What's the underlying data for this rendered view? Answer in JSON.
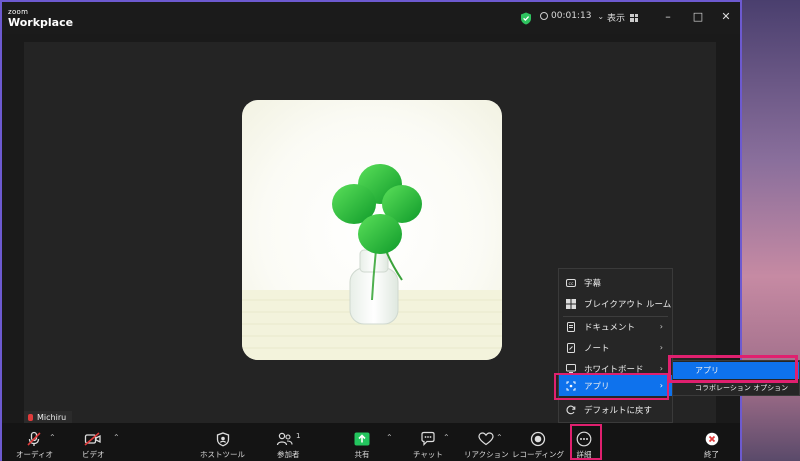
{
  "app": {
    "logo_top": "zoom",
    "logo_main": "Workplace"
  },
  "titlebar": {
    "timer": "00:01:13",
    "view_label": "表示"
  },
  "participant": {
    "name": "Michiru"
  },
  "toolbar": {
    "audio": "オーディオ",
    "video": "ビデオ",
    "host_tools": "ホストツール",
    "participants": "参加者",
    "participants_count": "1",
    "share": "共有",
    "chat": "チャット",
    "reactions": "リアクション",
    "recording": "レコーディング",
    "more": "詳細",
    "end": "終了"
  },
  "more_menu": {
    "items": [
      {
        "label": "字幕",
        "icon": "cc-icon"
      },
      {
        "label": "ブレイクアウト ルーム",
        "icon": "breakout-icon"
      },
      {
        "label": "ドキュメント",
        "icon": "document-icon",
        "submenu": true
      },
      {
        "label": "ノート",
        "icon": "notes-icon",
        "submenu": true
      },
      {
        "label": "ホワイトボード",
        "icon": "whiteboard-icon",
        "submenu": true
      },
      {
        "label": "アプリ",
        "icon": "apps-icon",
        "submenu": true,
        "active": true
      },
      {
        "label": "デフォルトに戻す",
        "icon": "reset-icon"
      }
    ]
  },
  "apps_submenu": {
    "items": [
      {
        "label": "アプリ",
        "active": true
      },
      {
        "label": "コラボレーション オプション"
      }
    ]
  },
  "colors": {
    "accent": "#0e72ed",
    "highlight": "#e0206f",
    "share": "#23c55e",
    "end": "#e03b3b"
  }
}
